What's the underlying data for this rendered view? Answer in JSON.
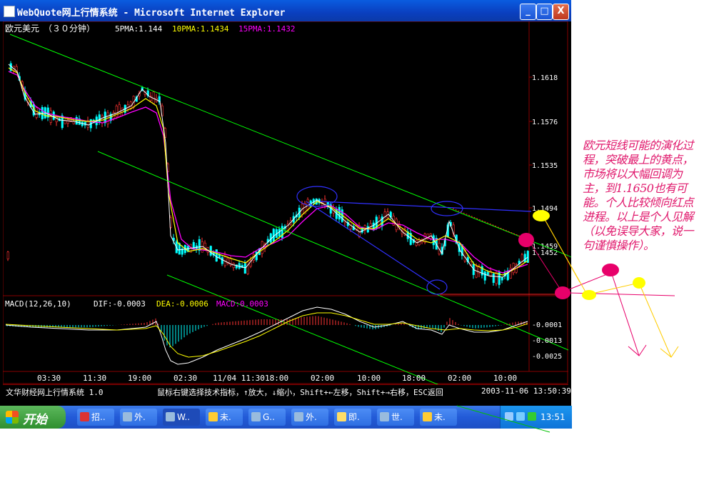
{
  "window": {
    "title": "WebQuote网上行情系统 - Microsoft Internet Explorer",
    "buttons": [
      "_",
      "□",
      "X"
    ]
  },
  "price_panel": {
    "symbol_label": "欧元美元",
    "period_label": "（３０分钟）",
    "ma5": "5PMA:1.144",
    "ma10": "10PMA:1.1434",
    "ma15": "15PMA:1.1432",
    "price_ticks": [
      "1.1618",
      "1.1576",
      "1.1535",
      "1.1494",
      "1.1459",
      "1.1452"
    ]
  },
  "macd_panel": {
    "params": "MACD(12,26,10)",
    "dif": "DIF:-0.0003",
    "dea": "DEA:-0.0006",
    "macd": "MACD:0.0003",
    "ticks": [
      "-0.0001",
      "-0.0013",
      "-0.0025"
    ]
  },
  "time_axis": [
    "03:30",
    "11:30",
    "19:00",
    "02:30",
    "11/04 11:30",
    "18:00",
    "02:00",
    "10:00",
    "18:00",
    "02:00",
    "10:00"
  ],
  "status_bar": {
    "left": "文华财经网上行情系统 1.0",
    "hint": "鼠标右键选择技术指标，↑放大，↓缩小，Shift+←左移，Shift+→右移，ESC返回",
    "datetime": "2003-11-06 13:50:39"
  },
  "taskbar": {
    "start_label": "开始",
    "tasks": [
      {
        "label": "招..",
        "icon_color": "#d33"
      },
      {
        "label": "外.",
        "icon_color": "#9bd"
      },
      {
        "label": "W..",
        "icon_color": "#9bd"
      },
      {
        "label": "未.",
        "icon_color": "#fc3"
      },
      {
        "label": "G..",
        "icon_color": "#9bd"
      },
      {
        "label": "外.",
        "icon_color": "#9bd"
      },
      {
        "label": "即.",
        "icon_color": "#fd6"
      },
      {
        "label": "世.",
        "icon_color": "#9bd"
      },
      {
        "label": "未.",
        "icon_color": "#fc3"
      }
    ],
    "clock": "13:51"
  },
  "annotation": {
    "text": "欧元短线可能的演化过程，突破最上的黄点，市场将以大幅回调为主，到1.1650也有可能。个人比较倾向红点进程。以上是个人见解（以免误导大家，说一句谨慎操作）。"
  },
  "colors": {
    "ma5": "#ffffff",
    "ma10": "#ffff00",
    "ma15": "#ff00ff",
    "candle_up": "#ff3333",
    "candle_down": "#00ffff",
    "channel": "#00ff00",
    "annotation": "#e0186c",
    "marker_yellow": "#ffff00",
    "marker_red": "#e8006a"
  }
}
